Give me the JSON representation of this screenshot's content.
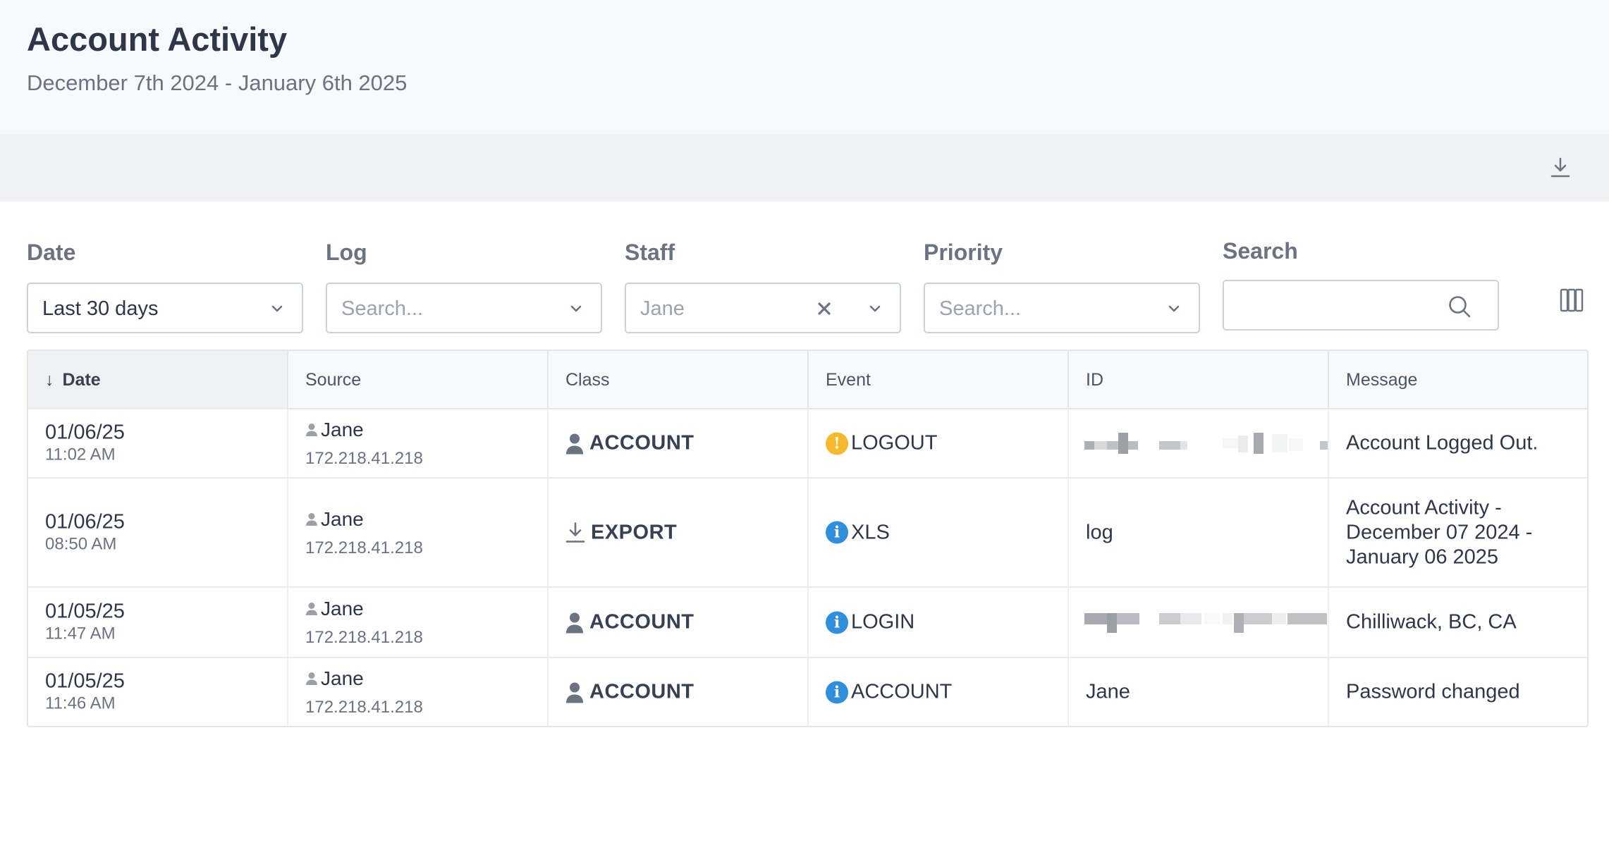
{
  "header": {
    "title": "Account Activity",
    "subtitle": "December 7th 2024 - January 6th 2025"
  },
  "toolbar": {
    "download_icon": "download-icon"
  },
  "filters": {
    "date": {
      "label": "Date",
      "value": "Last 30 days"
    },
    "log": {
      "label": "Log",
      "placeholder": "Search..."
    },
    "staff": {
      "label": "Staff",
      "value": "Jane"
    },
    "priority": {
      "label": "Priority",
      "placeholder": "Search..."
    },
    "search": {
      "label": "Search",
      "value": ""
    },
    "columns_icon": "columns-icon"
  },
  "table": {
    "columns": [
      "Date",
      "Source",
      "Class",
      "Event",
      "ID",
      "Message"
    ],
    "sorted_column": "Date",
    "sort_direction": "descending",
    "rows": [
      {
        "date": "01/06/25",
        "time": "11:02 AM",
        "user": "Jane",
        "ip": "172.218.41.218",
        "class": "ACCOUNT",
        "class_icon": "user-icon",
        "event": "LOGOUT",
        "event_level": "warning",
        "id": "",
        "id_redacted": true,
        "message": "Account Logged Out."
      },
      {
        "date": "01/06/25",
        "time": "08:50 AM",
        "user": "Jane",
        "ip": "172.218.41.218",
        "class": "EXPORT",
        "class_icon": "download-icon",
        "event": "XLS",
        "event_level": "info",
        "id": "log",
        "id_redacted": false,
        "message": "Account Activity - December 07 2024 - January 06 2025"
      },
      {
        "date": "01/05/25",
        "time": "11:47 AM",
        "user": "Jane",
        "ip": "172.218.41.218",
        "class": "ACCOUNT",
        "class_icon": "user-icon",
        "event": "LOGIN",
        "event_level": "info",
        "id": "",
        "id_redacted": true,
        "message": "Chilliwack, BC, CA"
      },
      {
        "date": "01/05/25",
        "time": "11:46 AM",
        "user": "Jane",
        "ip": "172.218.41.218",
        "class": "ACCOUNT",
        "class_icon": "user-icon",
        "event": "ACCOUNT",
        "event_level": "info",
        "id": "Jane",
        "id_redacted": false,
        "message": "Password changed"
      }
    ]
  },
  "colors": {
    "warning": "#f5b82e",
    "info": "#2f8fdd",
    "text": "#2d3748",
    "muted": "#6b7280"
  }
}
